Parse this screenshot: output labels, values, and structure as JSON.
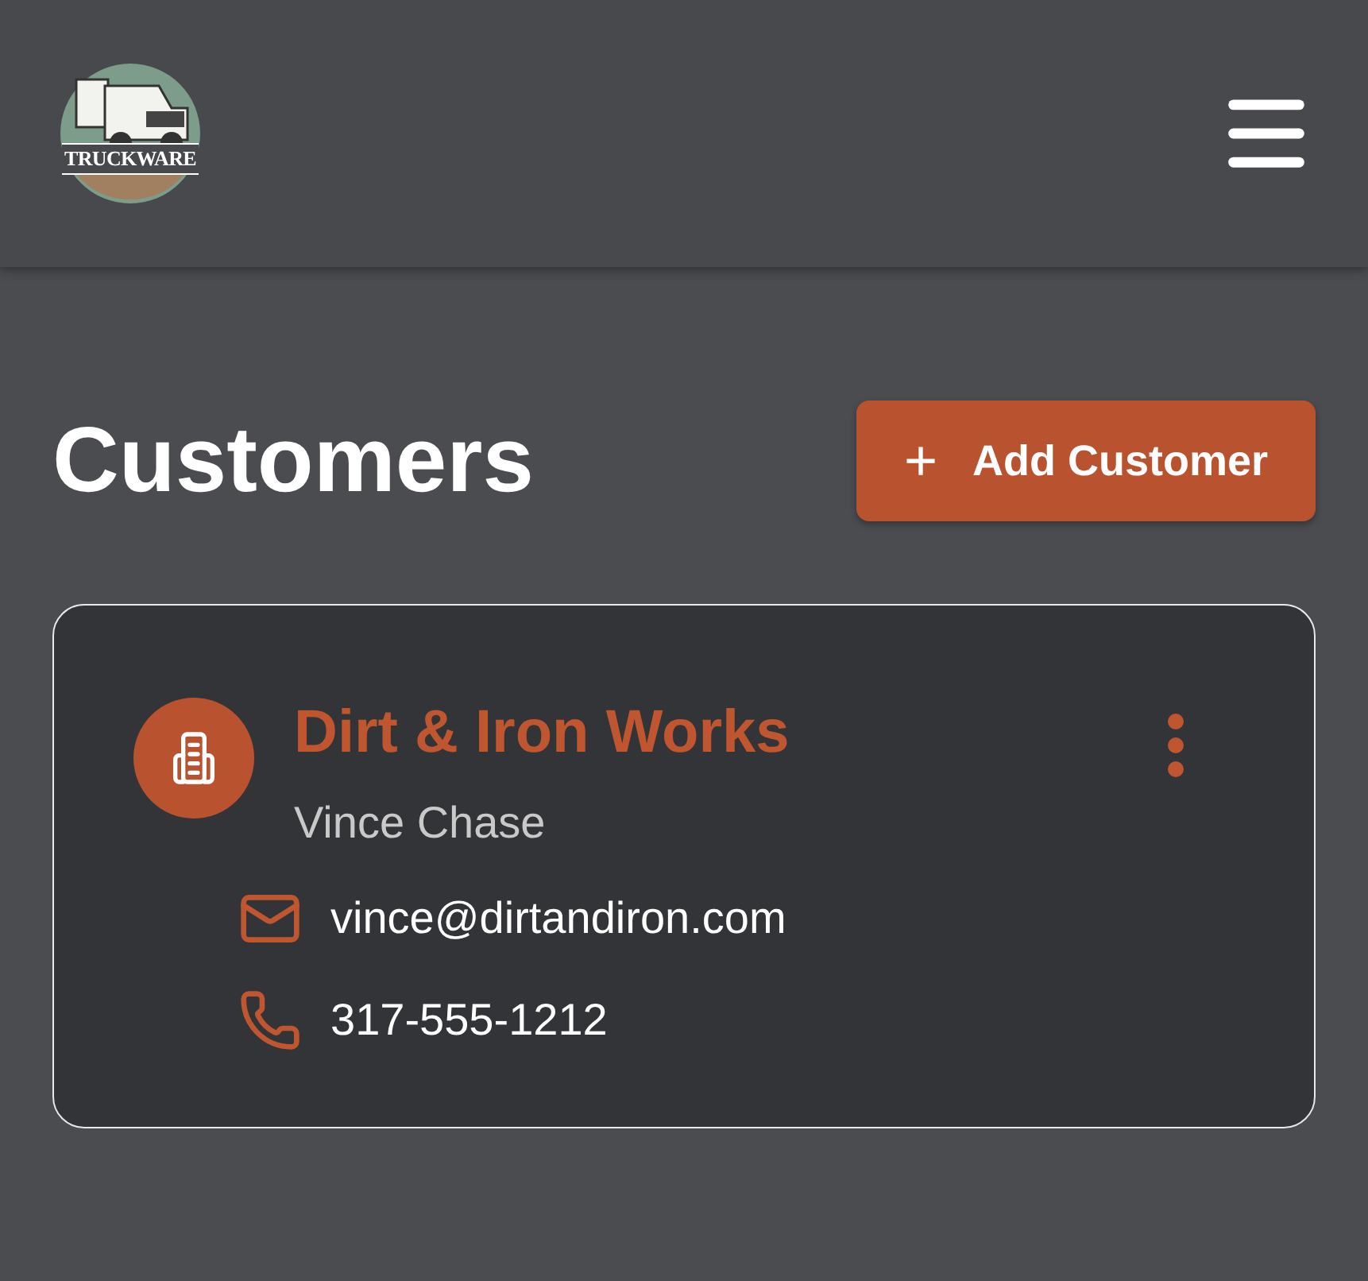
{
  "header": {
    "logo_text": "TRUCKWARE"
  },
  "page": {
    "title": "Customers",
    "add_button": {
      "icon": "+",
      "label": "Add Customer"
    }
  },
  "customers": [
    {
      "name": "Dirt & Iron Works",
      "contact": "Vince Chase",
      "email": "vince@dirtandiron.com",
      "phone": "317-555-1212"
    }
  ]
}
